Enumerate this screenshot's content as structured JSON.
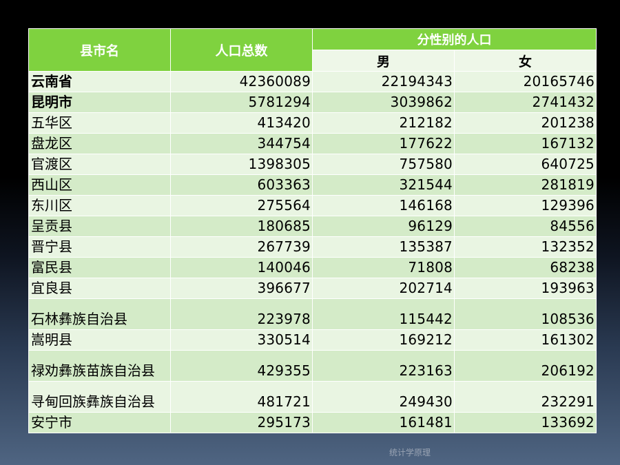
{
  "table": {
    "headers": {
      "county": "县市名",
      "total": "人口总数",
      "by_gender": "分性别的人口",
      "male": "男",
      "female": "女"
    },
    "rows": [
      {
        "name": "云南省",
        "total": "42360089",
        "male": "22194343",
        "female": "20165746",
        "bold": true
      },
      {
        "name": "昆明市",
        "total": "5781294",
        "male": "3039862",
        "female": "2741432",
        "bold": true
      },
      {
        "name": "五华区",
        "total": "413420",
        "male": "212182",
        "female": "201238"
      },
      {
        "name": "盘龙区",
        "total": "344754",
        "male": "177622",
        "female": "167132"
      },
      {
        "name": "官渡区",
        "total": "1398305",
        "male": "757580",
        "female": "640725"
      },
      {
        "name": "西山区",
        "total": "603363",
        "male": "321544",
        "female": "281819"
      },
      {
        "name": "东川区",
        "total": "275564",
        "male": "146168",
        "female": "129396"
      },
      {
        "name": "呈贡县",
        "total": "180685",
        "male": "96129",
        "female": "84556"
      },
      {
        "name": "晋宁县",
        "total": "267739",
        "male": "135387",
        "female": "132352"
      },
      {
        "name": "富民县",
        "total": "140046",
        "male": "71808",
        "female": "68238"
      },
      {
        "name": "宜良县",
        "total": "396677",
        "male": "202714",
        "female": "193963"
      },
      {
        "name": "石林彝族自治县",
        "total": "223978",
        "male": "115442",
        "female": "108536",
        "tall": true
      },
      {
        "name": "嵩明县",
        "total": "330514",
        "male": "169212",
        "female": "161302"
      },
      {
        "name": "禄劝彝族苗族自治县",
        "total": "429355",
        "male": "223163",
        "female": "206192",
        "tall": true
      },
      {
        "name": "寻甸回族彝族自治县",
        "total": "481721",
        "male": "249430",
        "female": "232291",
        "tall": true
      },
      {
        "name": "安宁市",
        "total": "295173",
        "male": "161481",
        "female": "133692"
      }
    ]
  },
  "footer": {
    "text": "统计学原理"
  },
  "colors": {
    "header_green": "#7fd23f",
    "row_light": "#e9f5e2",
    "row_dark": "#d4ebc8"
  }
}
